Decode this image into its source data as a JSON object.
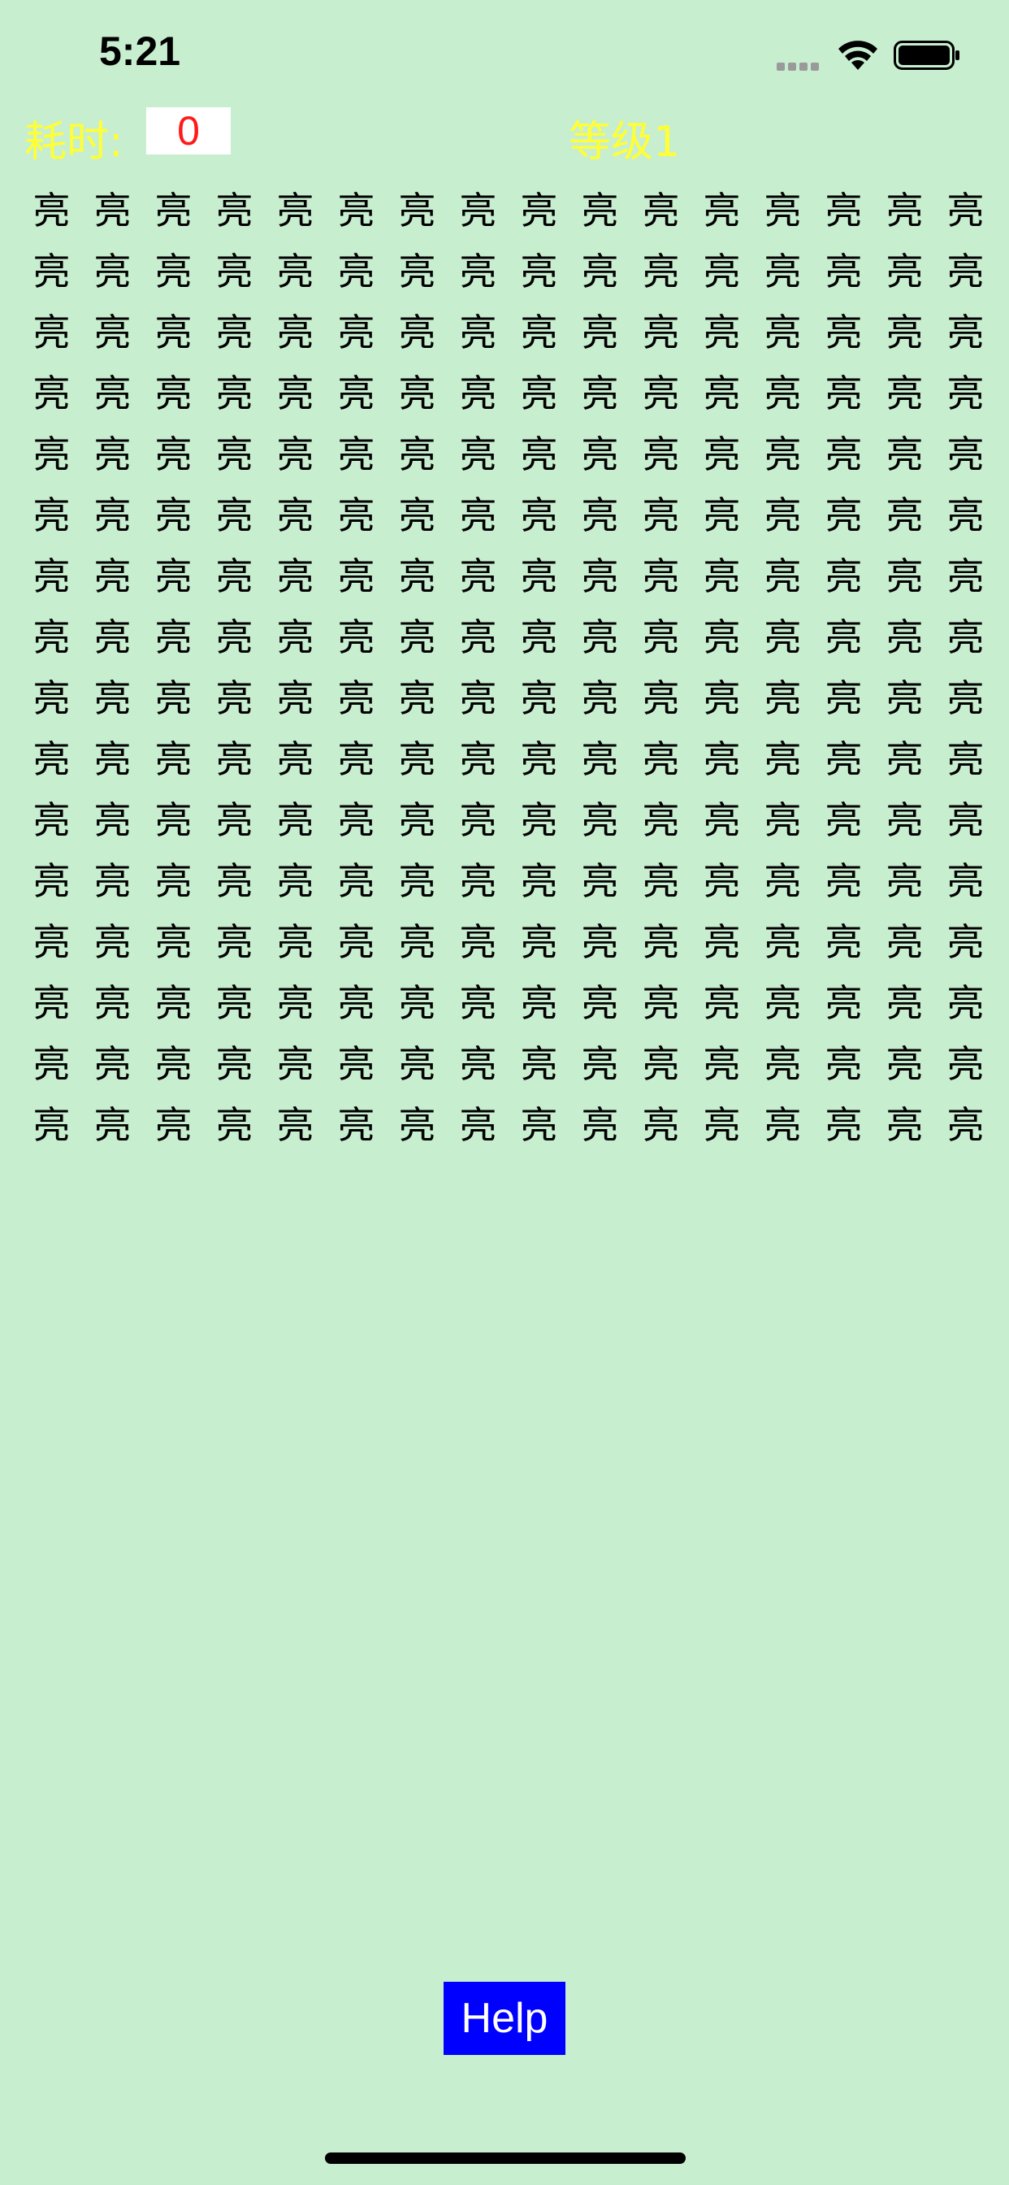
{
  "status_bar": {
    "time": "5:21"
  },
  "header": {
    "time_label": "耗时:",
    "time_value": "0",
    "level_label": "等级1"
  },
  "grid": {
    "rows": 16,
    "cols": 16,
    "char": "亮"
  },
  "help": {
    "label": "Help"
  },
  "colors": {
    "background": "#c8eed0",
    "label_yellow": "#ffff33",
    "counter_red": "#ff1a1a",
    "help_blue": "#0000ff"
  }
}
